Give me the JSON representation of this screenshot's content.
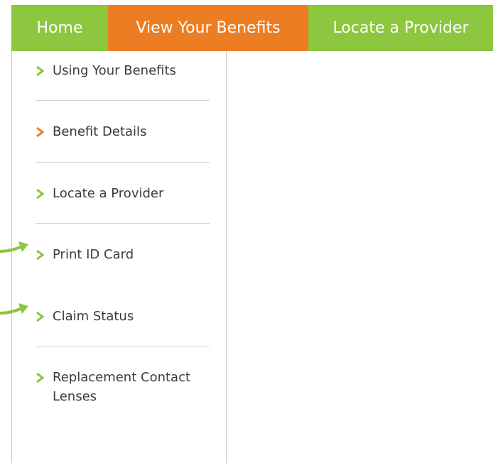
{
  "topnav": {
    "tabs": [
      {
        "label": "Home"
      },
      {
        "label": "View Your Benefits"
      },
      {
        "label": "Locate a Provider"
      }
    ],
    "active_tab": "View Your Benefits"
  },
  "sidebar": {
    "items": [
      {
        "label": "Using Your Benefits"
      },
      {
        "label": "Benefit Details"
      },
      {
        "label": "Locate a Provider"
      },
      {
        "label": "Print ID Card"
      },
      {
        "label": "Claim Status"
      },
      {
        "label": "Replacement Contact Lenses"
      }
    ],
    "active_item": "Benefit Details",
    "highlighted_items": [
      "Print ID Card",
      "Claim Status"
    ]
  },
  "colors": {
    "nav_green": "#8dc63f",
    "nav_orange": "#ed7d22",
    "chevron_green": "#8dc63f",
    "chevron_active": "#ed7d22",
    "callout_arrow": "#8dc63f"
  },
  "icons": {
    "menu_bullet": "chevron-right-icon",
    "callout": "arrow-right-icon"
  }
}
